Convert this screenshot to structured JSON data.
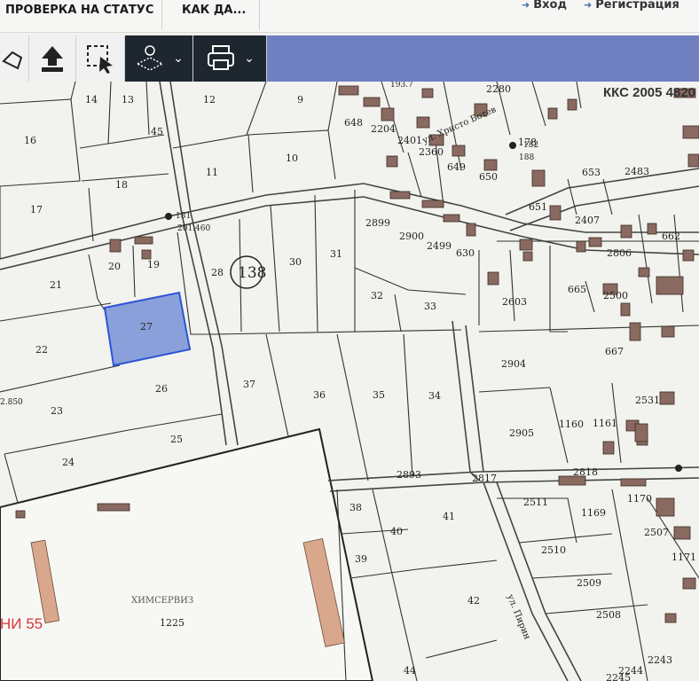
{
  "nav": {
    "item1": "ПРОВЕРКА НА СТАТУС",
    "item2": "КАК ДА...",
    "login": "Вход",
    "register": "Регистрация"
  },
  "toolbar": {
    "tools": [
      "map-pin-tool",
      "upload-icon",
      "select-area-icon",
      "layers-icon",
      "print-icon"
    ]
  },
  "map": {
    "cadastre_label": "ККС 2005 4820",
    "street1": "ул. Христо Ботев",
    "street2": "ул. Пирин",
    "company_label": "ХИМСЕРВИЗ",
    "overlay_text": "НИ 55",
    "circle_label": "138",
    "parcel_numbers": [
      "14",
      "13",
      "12",
      "9",
      "16",
      "45",
      "11",
      "10",
      "18",
      "17",
      "21",
      "20",
      "19",
      "28",
      "30",
      "31",
      "22",
      "27",
      "26",
      "37",
      "36",
      "35",
      "34",
      "23",
      "25",
      "24",
      "38",
      "40",
      "41",
      "39",
      "42",
      "1225",
      "44",
      "32",
      "33",
      "2280",
      "648",
      "2204",
      "2401",
      "2360",
      "649",
      "650",
      "178",
      "653",
      "2483",
      "651",
      "2407",
      "662",
      "2899",
      "2900",
      "2499",
      "630",
      "2806",
      "665",
      "2603",
      "2500",
      "2904",
      "667",
      "2531",
      "1160",
      "1161",
      "2905",
      "2818",
      "2511",
      "1169",
      "1170",
      "2510",
      "2507",
      "2509",
      "1171",
      "2508",
      "2244",
      "2243",
      "2245",
      "2893",
      "2817"
    ],
    "point_labels": [
      "193.7",
      "201.460",
      "181",
      "2.850",
      "188",
      "182"
    ]
  },
  "colors": {
    "selected_fill": "#8aa0da",
    "selected_stroke": "#2b55d6",
    "line": "#333333",
    "building": "#8a6a60",
    "bg": "#f2f2ee"
  }
}
